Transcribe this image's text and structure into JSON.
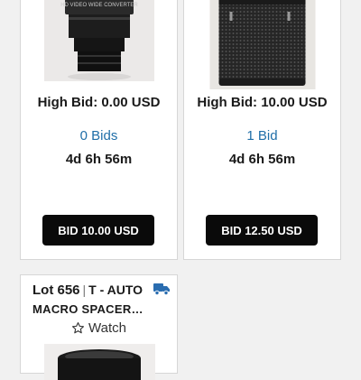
{
  "cards": [
    {
      "image_alt": "video wide converter lens",
      "image_label": "HD VIDEO WIDE CONVERTER",
      "high_bid": "High Bid: 0.00 USD",
      "bids": "0 Bids",
      "time_left": "4d 6h 56m",
      "button": "BID 10.00 USD"
    },
    {
      "image_alt": "lens with knurled grip",
      "high_bid": "High Bid: 10.00 USD",
      "bids": "1 Bid",
      "time_left": "4d 6h 56m",
      "button": "BID 12.50 USD"
    }
  ],
  "lot_card": {
    "lot_number": "Lot 656",
    "title_line1": "T - AUTO",
    "title_line2": "MACRO SPACER…",
    "watch": "Watch",
    "icons": {
      "shipping": "truck-icon",
      "watch": "star-outline-icon"
    }
  },
  "colors": {
    "link": "#1f6ea8",
    "button": "#0a0a0a",
    "shipping_icon": "#2a6db0"
  }
}
